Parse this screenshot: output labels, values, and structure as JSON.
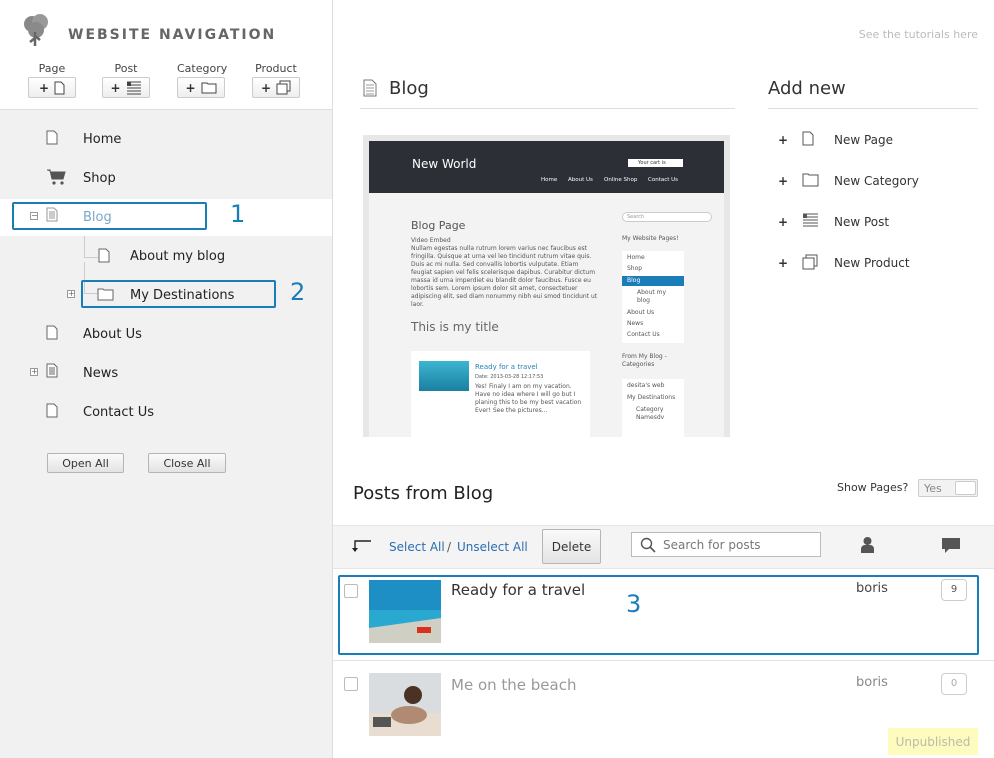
{
  "sidebar": {
    "brand": "WEBSITE NAVIGATION",
    "add_groups": [
      {
        "label": "Page",
        "icon": "page-icon"
      },
      {
        "label": "Post",
        "icon": "post-icon"
      },
      {
        "label": "Category",
        "icon": "folder-icon"
      },
      {
        "label": "Product",
        "icon": "product-icon"
      }
    ],
    "add_symbol": "+",
    "items": {
      "home": "Home",
      "shop": "Shop",
      "blog": "Blog",
      "about_blog": "About my blog",
      "destinations": "My Destinations",
      "about_us": "About Us",
      "news": "News",
      "contact": "Contact Us"
    },
    "open_all": "Open All",
    "close_all": "Close All"
  },
  "callouts": [
    "1",
    "2",
    "3"
  ],
  "header": {
    "tutorials": "See the tutorials here"
  },
  "blog_section": {
    "title": "Blog",
    "preview": {
      "site_title": "New World",
      "cart": "Your cart is empty",
      "nav": [
        "Home",
        "About Us",
        "Online Shop",
        "Contact Us"
      ],
      "page_title": "Blog Page",
      "video": "Video Embed",
      "body": "Nullam egestas nulla rutrum lorem varius nec faucibus est fringilla. Quisque at urna vel leo tincidunt rutrum vitae quis. Duis ac mi nulla. Sed convallis lobortis vulputate. Etiam feugiat sapien vel felis scelerisque dapibus. Curabitur dictum massa id urna imperdiet eu blandit dolor faucibus. Fusce eu lobortis sem. Lorem ipsum dolor sit amet, consectetuer adipiscing elit, sed diam nonummy nibh eui smod tincidunt ut laor.",
      "my_title": "This is my title",
      "post_link": "Ready for a travel",
      "post_date": "Date: 2013-03-28 12:17:53",
      "post_body": "Yes! Finaly I am on my vacation. Have no idea where I will go but I planing this to be my best vacation Ever! See the pictures...",
      "search": "Search",
      "pages_title": "My Website Pages!",
      "pages": [
        "Home",
        "Shop",
        "Blog",
        "About my blog",
        "About Us",
        "News",
        "Contact Us"
      ],
      "cat_title": "From My Blog - Categories",
      "cats": [
        "desita's web",
        "My Destinations",
        "Category Namesdv"
      ]
    }
  },
  "add_new": {
    "title": "Add new",
    "items": [
      "New Page",
      "New Category",
      "New Post",
      "New Product"
    ],
    "symbol": "+"
  },
  "posts": {
    "title": "Posts from Blog",
    "show_pages_label": "Show Pages?",
    "show_pages_value": "Yes",
    "select_all": "Select All",
    "separator": "/",
    "unselect_all": "Unselect All",
    "delete": "Delete",
    "search_placeholder": "Search for posts",
    "rows": [
      {
        "title": "Ready for a travel",
        "author": "boris",
        "comments": "9",
        "status": ""
      },
      {
        "title": "Me on the beach",
        "author": "boris",
        "comments": "0",
        "status": "Unpublished"
      }
    ]
  },
  "colors": {
    "accent": "#1a7db8",
    "link": "#2a6eb0",
    "unpublished_bg": "#fdfbbe"
  }
}
